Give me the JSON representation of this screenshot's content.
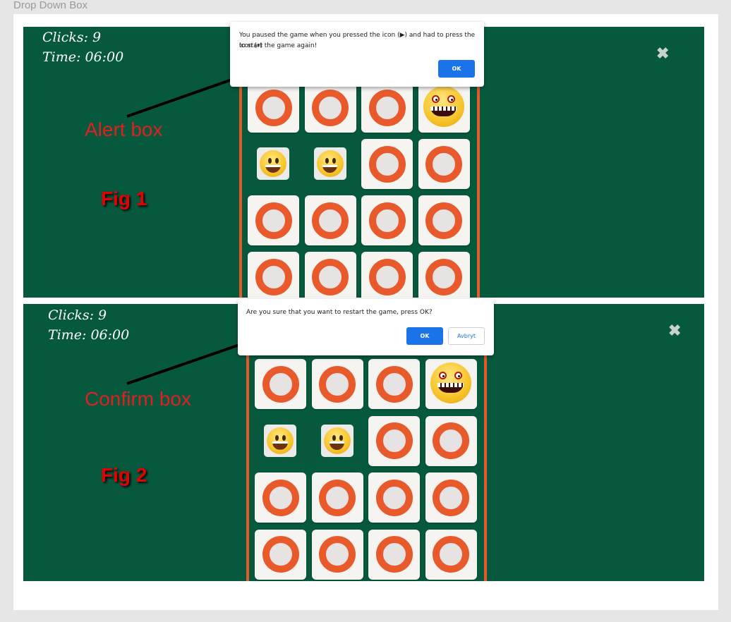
{
  "frame_title": "Drop Down Box",
  "colors": {
    "panel_bg": "#07593e",
    "tile_ring": "#e85a2c",
    "ok_button": "#1a73e8",
    "annotation": "#e02020"
  },
  "fig1": {
    "hud": {
      "clicks": "Clicks: 9",
      "time": "Time: 06:00"
    },
    "close_icon": "✖",
    "annotation_label": "Alert box",
    "fig_label": "Fig 1",
    "dialog": {
      "line1": "You paused the game when you pressed  the icon (▶) and had to press the icon (⏸)",
      "line2": "to start the game again!",
      "ok_label": "OK"
    }
  },
  "fig2": {
    "hud": {
      "clicks": "Clicks: 9",
      "time": "Time: 06:00"
    },
    "close_icon": "✖",
    "annotation_label": "Confirm box",
    "fig_label": "Fig 2",
    "dialog": {
      "message": "Are you sure that you want to restart the game, press OK?",
      "ok_label": "OK",
      "cancel_label": "Avbryt"
    }
  },
  "board_layout": [
    [
      "ring",
      "ring",
      "ring",
      "monster-emoji"
    ],
    [
      "smiley-emoji",
      "smiley-emoji",
      "ring",
      "ring"
    ],
    [
      "ring",
      "ring",
      "ring",
      "ring"
    ],
    [
      "ring",
      "ring",
      "ring",
      "ring"
    ]
  ]
}
